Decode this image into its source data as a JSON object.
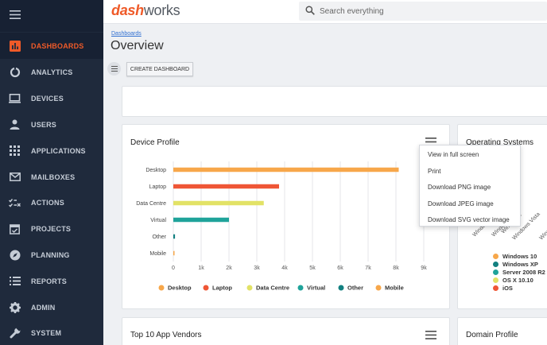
{
  "app": {
    "logo_accent": "dash",
    "logo_rest": "works",
    "brand_color": "#ef5a28"
  },
  "search": {
    "placeholder": "Search everything"
  },
  "sidebar": {
    "items": [
      {
        "label": "DASHBOARDS",
        "icon": "bar-chart-icon",
        "active": true
      },
      {
        "label": "ANALYTICS",
        "icon": "donut-chart-icon"
      },
      {
        "label": "DEVICES",
        "icon": "laptop-icon"
      },
      {
        "label": "USERS",
        "icon": "user-icon"
      },
      {
        "label": "APPLICATIONS",
        "icon": "apps-grid-icon"
      },
      {
        "label": "MAILBOXES",
        "icon": "mail-icon"
      },
      {
        "label": "ACTIONS",
        "icon": "actions-checklist-icon"
      },
      {
        "label": "PROJECTS",
        "icon": "calendar-check-icon"
      },
      {
        "label": "PLANNING",
        "icon": "compass-icon"
      },
      {
        "label": "REPORTS",
        "icon": "list-icon"
      },
      {
        "label": "ADMIN",
        "icon": "gear-icon"
      },
      {
        "label": "SYSTEM",
        "icon": "wrench-icon"
      }
    ]
  },
  "header": {
    "breadcrumb": "Dashboards",
    "title": "Overview"
  },
  "toolbar": {
    "create_label": "CREATE DASHBOARD"
  },
  "cards": {
    "device_profile": "Device Profile",
    "operating_systems": "Operating Systems",
    "top_vendors": "Top 10 App Vendors",
    "domain_profile": "Domain Profile"
  },
  "context_menu": {
    "items": [
      "View in full screen",
      "Print",
      "Download PNG image",
      "Download JPEG image",
      "Download SVG vector image"
    ]
  },
  "chart_data": {
    "type": "bar",
    "orientation": "horizontal",
    "title": "Device Profile",
    "categories": [
      "Desktop",
      "Laptop",
      "Data Centre",
      "Virtual",
      "Other",
      "Mobile"
    ],
    "values": [
      8100,
      3800,
      3250,
      2000,
      60,
      30
    ],
    "colors": [
      "#f7a74a",
      "#ef5636",
      "#e2e266",
      "#1fa39a",
      "#128080",
      "#f7a74a"
    ],
    "xticks": [
      "0",
      "1k",
      "2k",
      "3k",
      "4k",
      "5k",
      "6k",
      "7k",
      "8k",
      "9k"
    ],
    "xlim": [
      0,
      9000
    ],
    "grid": true,
    "legend_position": "bottom"
  },
  "os_chart": {
    "axis_labels": [
      "Windows 10",
      "Windows XP",
      "Windows 7",
      "Windows Vista",
      "Windows"
    ],
    "legend": [
      {
        "name": "Windows 10",
        "color": "#f7a74a"
      },
      {
        "name": "Windows XP",
        "color": "#128080"
      },
      {
        "name": "Server 2008 R2",
        "color": "#1fa39a"
      },
      {
        "name": "OS X 10.10",
        "color": "#e2e266"
      },
      {
        "name": "iOS",
        "color": "#ef5636"
      }
    ]
  }
}
